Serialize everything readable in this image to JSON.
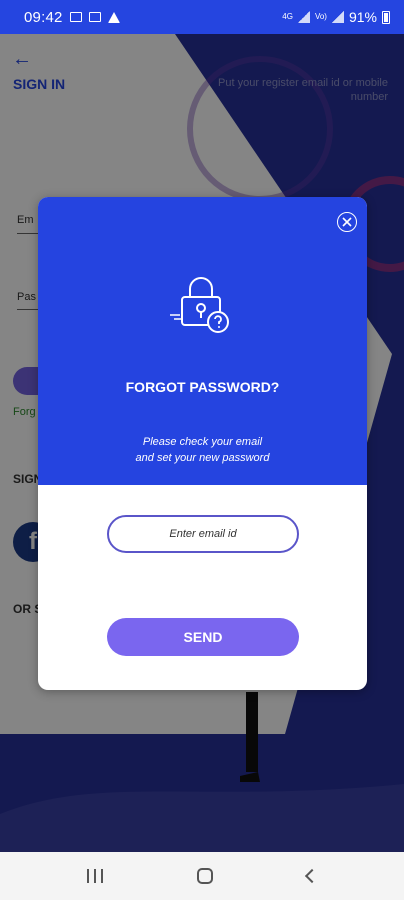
{
  "status_bar": {
    "time": "09:42",
    "network_label": "4G",
    "volte_label": "Vo)",
    "battery_percent": "91%"
  },
  "background": {
    "back_arrow": "←",
    "title": "SIGN IN",
    "hint": "Put your  register email id or mobile number",
    "email_fragment": "Em",
    "password_fragment": "Pas",
    "forgot_fragment": "Forg",
    "sign_fragment": "SIGN",
    "facebook_glyph": "f",
    "or_fragment": "OR S"
  },
  "modal": {
    "title": "FORGOT PASSWORD?",
    "message_line1": "Please check your email",
    "message_line2": "and set your new password",
    "email_placeholder": "Enter email id",
    "send_label": "SEND",
    "icons": [
      "lock-question-icon",
      "close-icon"
    ]
  },
  "nav_bar": {
    "icons": [
      "recents-icon",
      "home-icon",
      "back-icon"
    ]
  },
  "colors": {
    "modal_blue": "#2544e0",
    "send_button": "#7a66ef",
    "input_border": "#5a55c9",
    "background_navy": "#27309a"
  }
}
